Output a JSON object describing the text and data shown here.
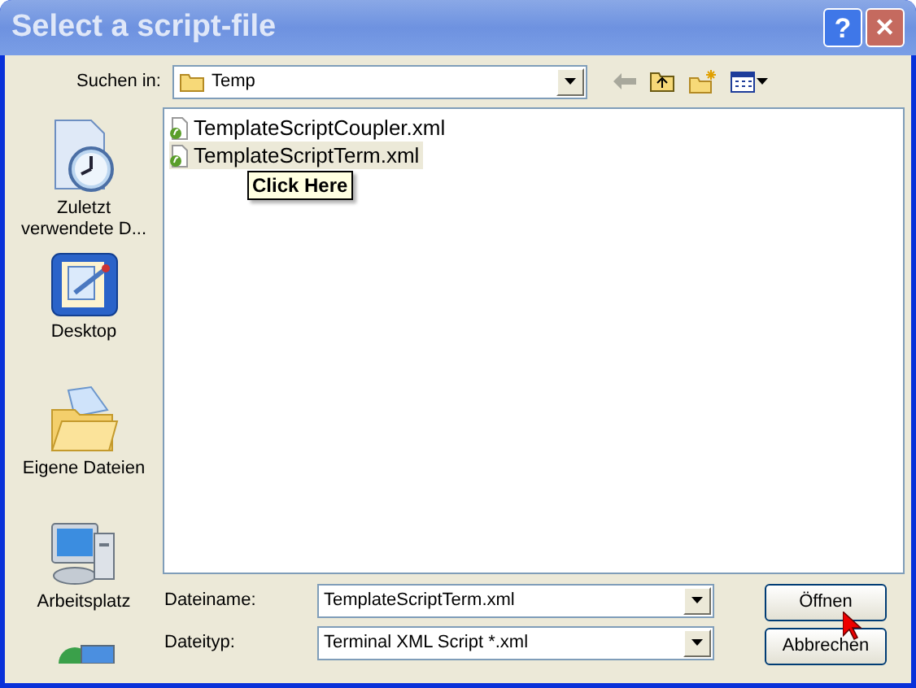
{
  "window": {
    "title": "Select a script-file",
    "help": "?",
    "close": "✕"
  },
  "look_in": {
    "label": "Suchen in:",
    "value": "Temp"
  },
  "places": [
    {
      "label": "Zuletzt verwendete D..."
    },
    {
      "label": "Desktop"
    },
    {
      "label": "Eigene Dateien"
    },
    {
      "label": "Arbeitsplatz"
    }
  ],
  "files": [
    {
      "name": "TemplateScriptCoupler.xml",
      "selected": false
    },
    {
      "name": "TemplateScriptTerm.xml",
      "selected": true
    }
  ],
  "tooltip": "Click Here",
  "file_name": {
    "label": "Dateiname:",
    "value": "TemplateScriptTerm.xml"
  },
  "file_type": {
    "label": "Dateityp:",
    "value": "Terminal XML Script *.xml"
  },
  "buttons": [
    "Öffnen",
    "Abbrechen"
  ]
}
